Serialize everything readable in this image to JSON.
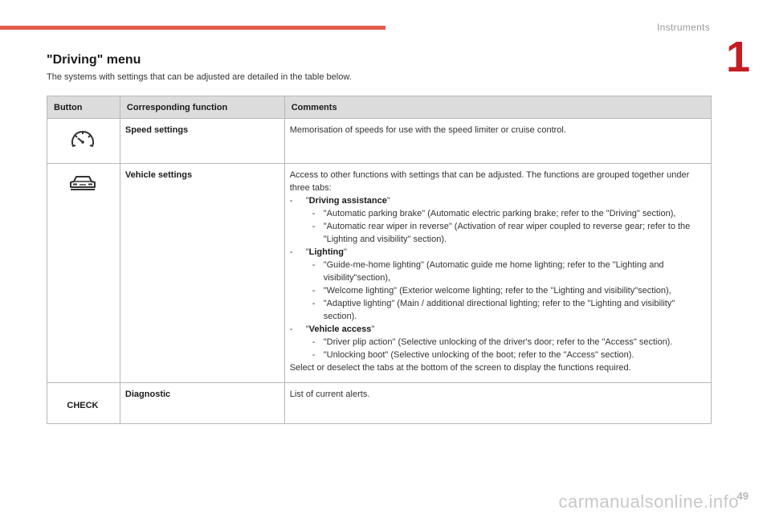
{
  "header": {
    "chapter_name": "Instruments",
    "chapter_number": "1"
  },
  "section": {
    "title": "\"Driving\" menu",
    "intro": "The systems with settings that can be adjusted are detailed in the table below."
  },
  "table": {
    "headers": [
      "Button",
      "Corresponding function",
      "Comments"
    ],
    "rows": {
      "speed": {
        "icon": "speedometer-icon",
        "function": "Speed settings",
        "comment": "Memorisation of speeds for use with the speed limiter or cruise control."
      },
      "vehicle": {
        "icon": "car-icon",
        "function": "Vehicle settings",
        "intro": "Access to other functions with settings that can be adjusted. The functions are grouped together under three tabs:",
        "tabs": [
          {
            "name": "Driving assistance",
            "items": [
              "\"Automatic parking brake\" (Automatic electric parking brake; refer to the \"Driving\" section),",
              "\"Automatic rear wiper in reverse\" (Activation of rear wiper coupled to reverse gear; refer to the \"Lighting and visibility\" section)."
            ]
          },
          {
            "name": "Lighting",
            "items": [
              "\"Guide-me-home lighting\" (Automatic guide me home lighting; refer to the \"Lighting and visibility\"section),",
              "\"Welcome lighting\" (Exterior welcome lighting; refer to the \"Lighting and visibility\"section),",
              "\"Adaptive lighting\" (Main / additional directional lighting; refer to the \"Lighting and visibility\" section)."
            ]
          },
          {
            "name": "Vehicle access",
            "items": [
              "\"Driver plip action\" (Selective unlocking of the driver's door; refer to the \"Access\" section).",
              "\"Unlocking boot\" (Selective unlocking of the boot; refer to the \"Access\" section)."
            ]
          }
        ],
        "outro": "Select or deselect the tabs at the bottom of the screen to display the functions required."
      },
      "diagnostic": {
        "button_label": "CHECK",
        "function": "Diagnostic",
        "comment": "List of current alerts."
      }
    }
  },
  "footer": {
    "page_number": "49",
    "watermark": "carmanualsonline.info"
  },
  "colors": {
    "accent_bar": "#e55a4b",
    "chapter_number": "#c41e24",
    "header_bg": "#dcdcdc"
  }
}
